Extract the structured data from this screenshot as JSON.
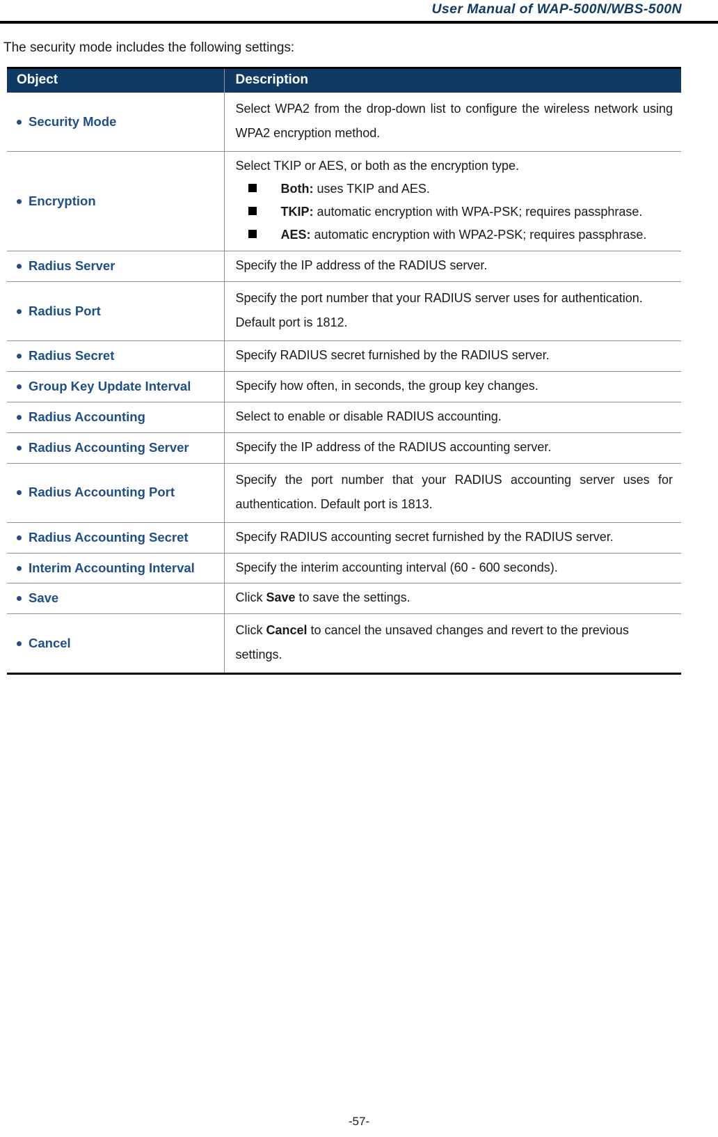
{
  "header": {
    "title": "User Manual of WAP-500N/WBS-500N"
  },
  "intro": {
    "text": "The security mode includes the following settings:"
  },
  "table": {
    "columns": {
      "object": "Object",
      "description": "Description"
    },
    "rows": [
      {
        "object": "Security Mode",
        "description": "Select WPA2 from the drop-down list to configure the wireless network using WPA2 encryption method."
      },
      {
        "object": "Encryption",
        "description": "Select TKIP or AES, or both as the encryption type.",
        "sub_items": [
          {
            "term": "Both:",
            "text": " uses TKIP and AES."
          },
          {
            "term": "TKIP:",
            "text": " automatic encryption with WPA-PSK; requires passphrase."
          },
          {
            "term": "AES:",
            "text": " automatic encryption with WPA2-PSK; requires passphrase."
          }
        ]
      },
      {
        "object": "Radius Server",
        "description": "Specify the IP address of the RADIUS server."
      },
      {
        "object": "Radius Port",
        "description": "Specify the port number that your RADIUS server uses for authentication. Default port is 1812."
      },
      {
        "object": "Radius Secret",
        "description": "Specify RADIUS secret furnished by the RADIUS server."
      },
      {
        "object": "Group Key Update Interval",
        "description": "Specify how often, in seconds, the group key changes."
      },
      {
        "object": "Radius Accounting",
        "description": "Select to enable or disable RADIUS accounting."
      },
      {
        "object": "Radius Accounting Server",
        "description": "Specify the IP address of the RADIUS accounting server."
      },
      {
        "object": "Radius Accounting Port",
        "description": "Specify the port number that your RADIUS accounting server uses for authentication. Default port is 1813."
      },
      {
        "object": "Radius Accounting Secret",
        "description": "Specify RADIUS accounting secret furnished by the RADIUS server."
      },
      {
        "object": "Interim Accounting Interval",
        "description": "Specify the interim accounting interval (60 - 600 seconds)."
      },
      {
        "object": "Save",
        "description_prefix": "Click ",
        "description_strong": "Save",
        "description_suffix": " to save the settings."
      },
      {
        "object": "Cancel",
        "description_prefix": "Click ",
        "description_strong": "Cancel",
        "description_suffix": " to cancel the unsaved changes and revert to the previous settings."
      }
    ]
  },
  "footer": {
    "page_number": "-57-"
  },
  "colors": {
    "header_navy": "#0E3A63",
    "label_blue": "#1F4E89",
    "title_blue": "#123B63"
  }
}
